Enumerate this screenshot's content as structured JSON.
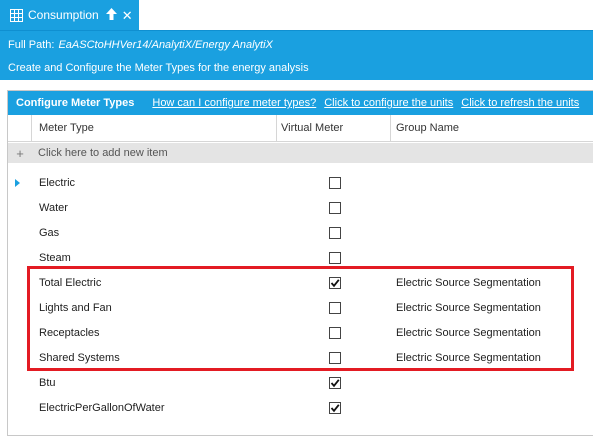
{
  "tab": {
    "title": "Consumption",
    "pin_glyph": "🡅",
    "close_glyph": "✕"
  },
  "info": {
    "path_label": "Full Path:",
    "path_value": "EaASCtoHHVer14/AnalytiX/Energy AnalytiX",
    "description": "Create and Configure the Meter Types for the energy analysis"
  },
  "panel": {
    "title": "Configure Meter Types",
    "links": [
      "How can I configure meter types?",
      "Click to configure the units",
      "Click to refresh the units"
    ]
  },
  "grid": {
    "columns": [
      "Meter Type",
      "Virtual Meter",
      "Group Name"
    ],
    "add_row_label": "Click here to add new item",
    "rows": [
      {
        "name": "Electric",
        "virtual": false,
        "group": "",
        "current": true
      },
      {
        "name": "Water",
        "virtual": false,
        "group": ""
      },
      {
        "name": "Gas",
        "virtual": false,
        "group": ""
      },
      {
        "name": "Steam",
        "virtual": false,
        "group": ""
      },
      {
        "name": "Total Electric",
        "virtual": true,
        "group": "Electric Source Segmentation"
      },
      {
        "name": "Lights and Fan",
        "virtual": false,
        "group": "Electric Source Segmentation"
      },
      {
        "name": "Receptacles",
        "virtual": false,
        "group": "Electric Source Segmentation"
      },
      {
        "name": "Shared Systems",
        "virtual": false,
        "group": "Electric Source Segmentation"
      },
      {
        "name": "Btu",
        "virtual": true,
        "group": ""
      },
      {
        "name": "ElectricPerGallonOfWater",
        "virtual": true,
        "group": ""
      }
    ]
  },
  "colors": {
    "accent": "#1aa0e0",
    "highlight": "#e31b23",
    "add_row_bg": "#e4e4e4"
  }
}
